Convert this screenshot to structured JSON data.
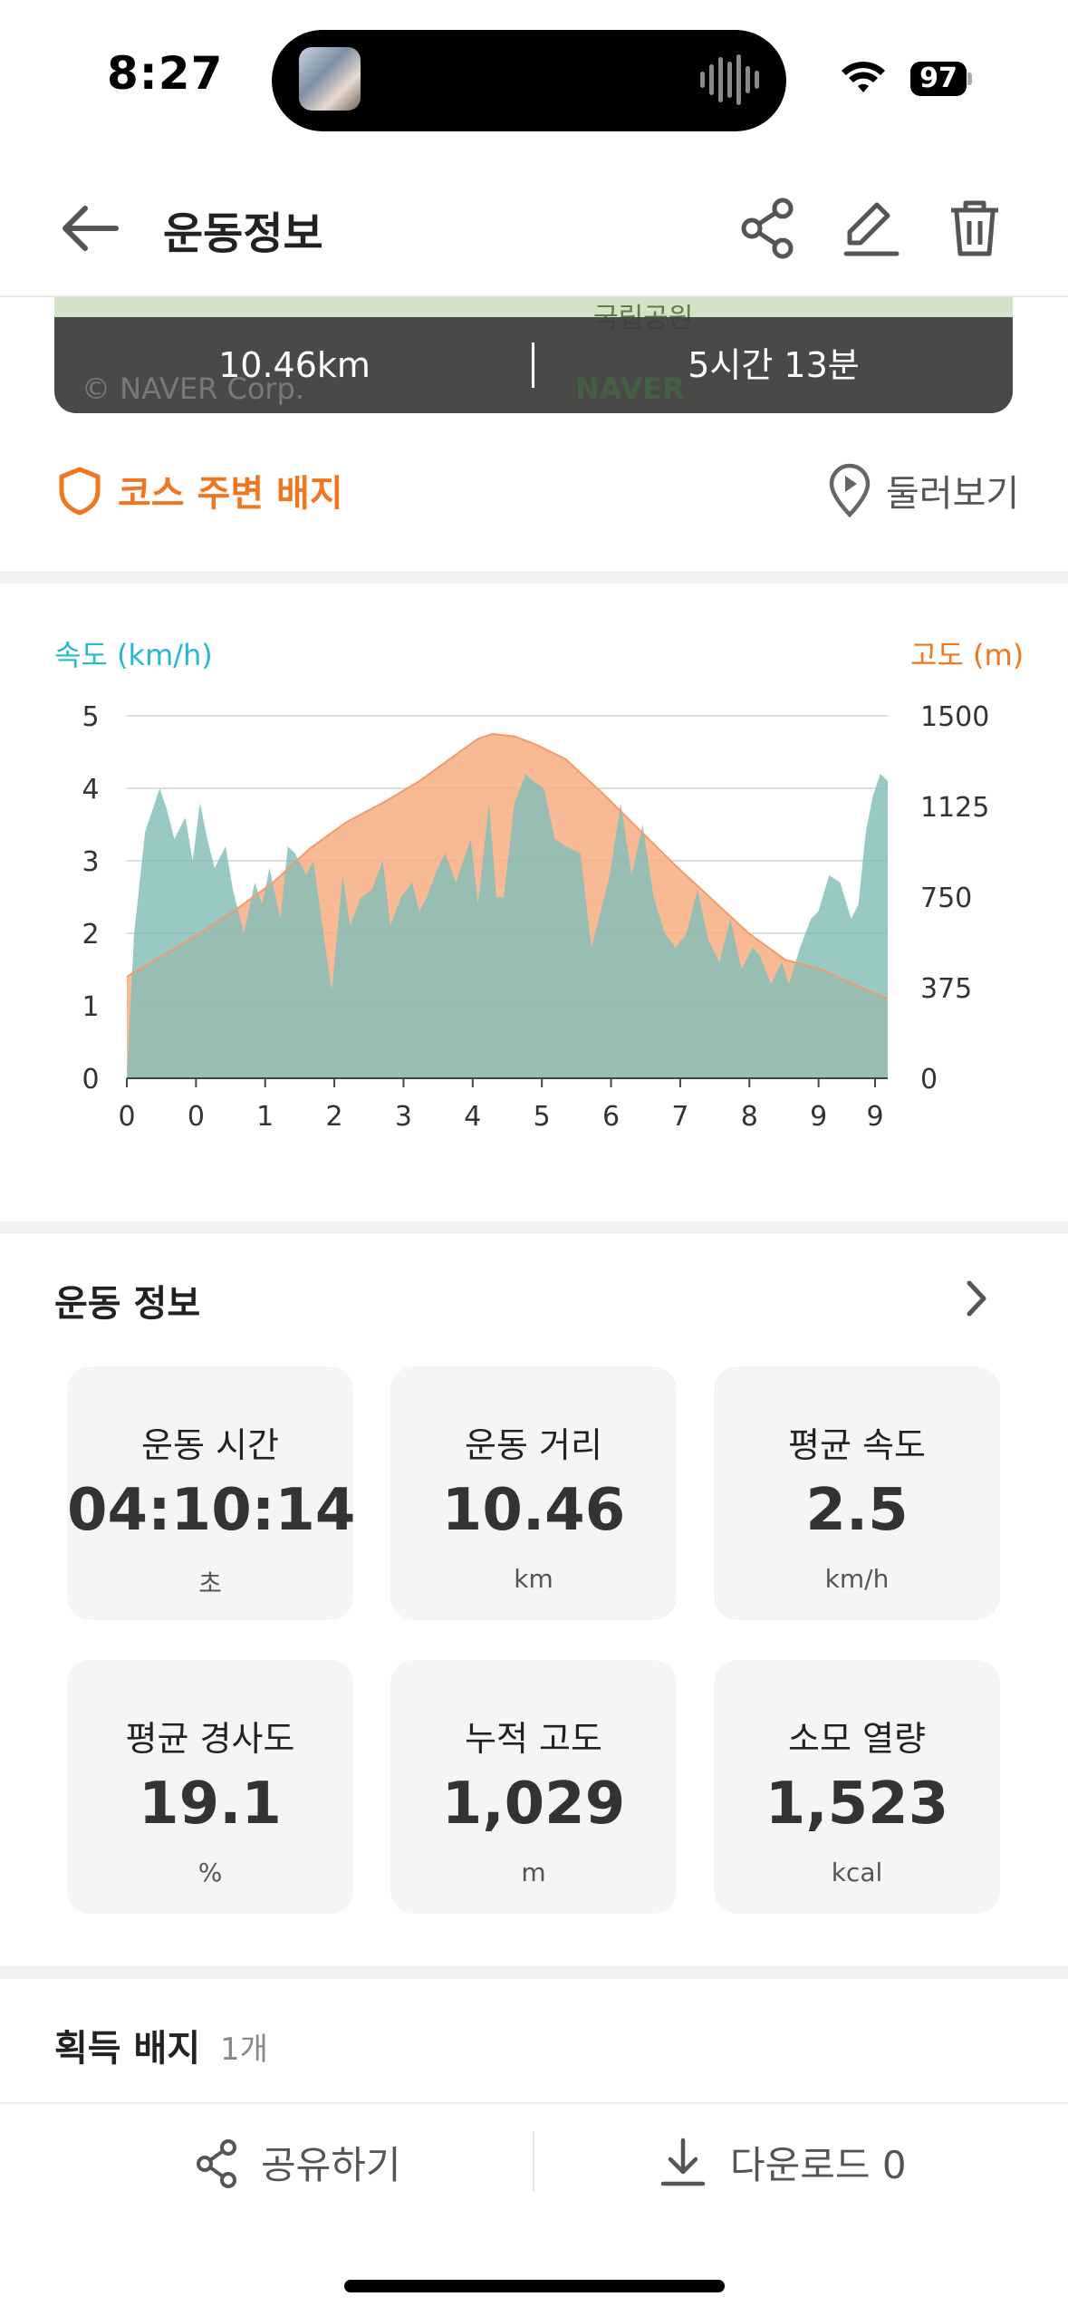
{
  "status": {
    "time": "8:27",
    "battery": "97"
  },
  "header": {
    "title": "운동정보"
  },
  "map": {
    "distance": "10.46km",
    "duration": "5시간 13분",
    "copyright": "© NAVER Corp.",
    "logo": "NAVER",
    "place": "국립공원"
  },
  "badge_row": {
    "label": "코스 주변 배지",
    "look_around": "둘러보기"
  },
  "chart_data": {
    "type": "area",
    "left_axis_label": "속도 (km/h)",
    "right_axis_label": "고도 (m)",
    "x_ticks": [
      "0",
      "0",
      "1",
      "2",
      "3",
      "4",
      "5",
      "6",
      "7",
      "8",
      "9",
      "9"
    ],
    "y_left_ticks": [
      "0",
      "1",
      "2",
      "3",
      "4",
      "5"
    ],
    "y_right_ticks": [
      "0",
      "375",
      "750",
      "1125",
      "1500"
    ],
    "ylim_left": [
      0,
      5
    ],
    "ylim_right": [
      0,
      1500
    ],
    "grid": true,
    "series": [
      {
        "name": "속도 (km/h)",
        "axis": "left",
        "color": "#7fd8e0",
        "x": [
          0.0,
          0.1,
          0.25,
          0.45,
          0.55,
          0.65,
          0.8,
          0.9,
          1.0,
          1.1,
          1.2,
          1.35,
          1.45,
          1.6,
          1.75,
          1.85,
          1.95,
          2.1,
          2.2,
          2.3,
          2.45,
          2.55,
          2.7,
          2.8,
          2.95,
          3.05,
          3.2,
          3.35,
          3.5,
          3.6,
          3.75,
          3.9,
          4.0,
          4.1,
          4.25,
          4.35,
          4.5,
          4.7,
          4.8,
          4.95,
          5.05,
          5.15,
          5.3,
          5.45,
          5.55,
          5.7,
          5.85,
          6.0,
          6.2,
          6.35,
          6.5,
          6.6,
          6.75,
          6.9,
          7.05,
          7.2,
          7.35,
          7.5,
          7.65,
          7.8,
          7.95,
          8.1,
          8.25,
          8.4,
          8.55,
          8.65,
          8.8,
          8.95,
          9.05,
          9.2,
          9.35,
          9.45,
          9.6,
          9.75,
          9.9,
          10.0,
          10.1,
          10.2,
          10.3,
          10.4
        ],
        "y": [
          0.0,
          2.0,
          3.4,
          4.0,
          3.7,
          3.3,
          3.6,
          3.0,
          3.8,
          3.3,
          2.9,
          3.2,
          2.6,
          2.0,
          2.7,
          2.4,
          2.9,
          2.2,
          3.2,
          3.1,
          2.8,
          3.0,
          1.9,
          1.2,
          2.8,
          2.1,
          2.5,
          2.6,
          3.0,
          2.1,
          2.5,
          2.7,
          2.3,
          2.5,
          2.9,
          3.1,
          2.7,
          3.3,
          2.4,
          3.8,
          2.5,
          2.5,
          3.8,
          4.2,
          4.1,
          4.0,
          3.3,
          3.2,
          3.1,
          1.8,
          2.4,
          2.8,
          3.8,
          2.8,
          3.5,
          2.5,
          2.0,
          1.8,
          2.0,
          2.6,
          1.9,
          1.6,
          2.2,
          1.5,
          1.8,
          1.7,
          1.3,
          1.6,
          1.3,
          1.8,
          2.2,
          2.3,
          2.8,
          2.7,
          2.2,
          2.4,
          3.4,
          3.9,
          4.2,
          4.1
        ]
      },
      {
        "name": "고도 (m)",
        "axis": "right",
        "color": "#f7ae82",
        "x": [
          0.0,
          0.5,
          1.0,
          1.5,
          2.0,
          2.5,
          3.0,
          3.5,
          4.0,
          4.5,
          4.8,
          5.0,
          5.3,
          5.6,
          6.0,
          6.5,
          7.0,
          7.5,
          8.0,
          8.5,
          9.0,
          9.5,
          10.0,
          10.4
        ],
        "y": [
          420,
          510,
          600,
          700,
          810,
          950,
          1060,
          1140,
          1230,
          1340,
          1405,
          1425,
          1415,
          1380,
          1320,
          1180,
          1030,
          880,
          740,
          600,
          490,
          450,
          380,
          330
        ]
      }
    ]
  },
  "info": {
    "title": "운동 정보",
    "cards": [
      {
        "label": "운동 시간",
        "value": "04:10:14",
        "unit": "초"
      },
      {
        "label": "운동 거리",
        "value": "10.46",
        "unit": "km"
      },
      {
        "label": "평균 속도",
        "value": "2.5",
        "unit": "km/h"
      },
      {
        "label": "평균 경사도",
        "value": "19.1",
        "unit": "%"
      },
      {
        "label": "누적 고도",
        "value": "1,029",
        "unit": "m"
      },
      {
        "label": "소모 열량",
        "value": "1,523",
        "unit": "kcal"
      }
    ]
  },
  "earned": {
    "title": "획득 배지",
    "count": "1개"
  },
  "bottom": {
    "share": "공유하기",
    "download": "다운로드 0"
  }
}
